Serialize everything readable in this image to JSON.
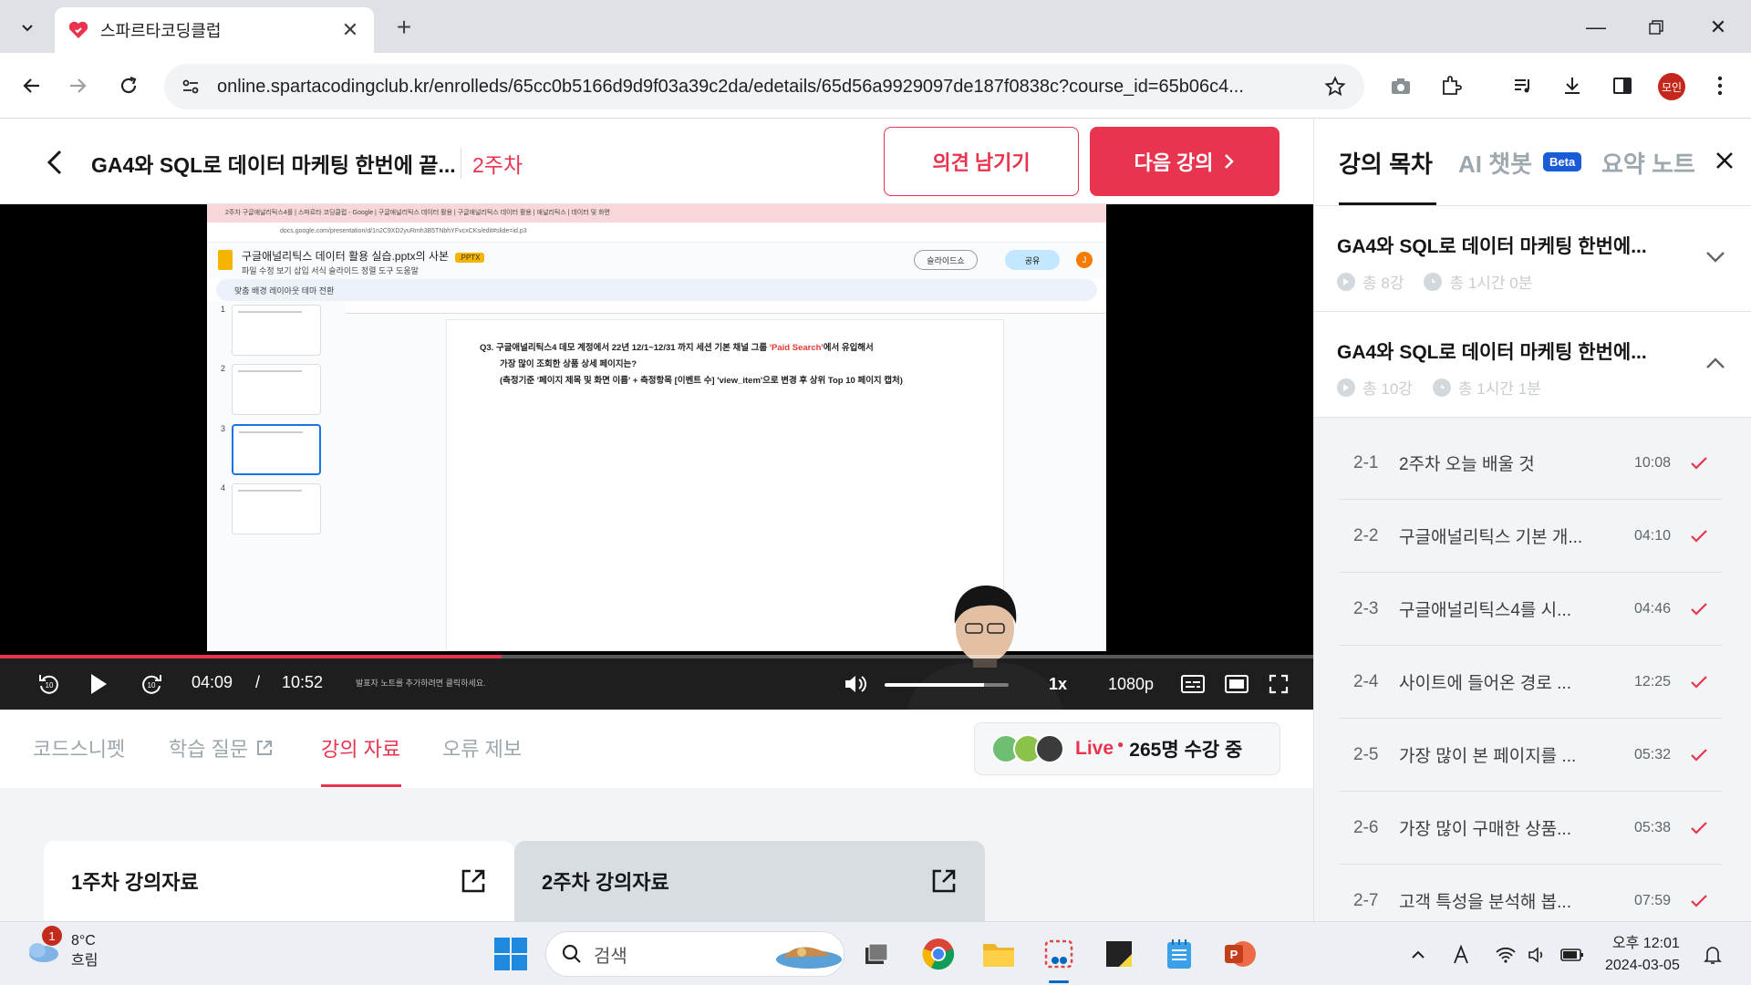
{
  "browser": {
    "tab_title": "스파르타코딩클럽",
    "url": "online.spartacodingclub.kr/enrolleds/65cc0b5166d9d9f03a39c2da/edetails/65d56a9929097de187f0838c?course_id=65b06c4...",
    "profile_label": "모인"
  },
  "header": {
    "course_title": "GA4와 SQL로 데이터 마케팅 한번에 끝...",
    "week_label": "2주차",
    "feedback_button": "의견 남기기",
    "next_button": "다음 강의"
  },
  "video": {
    "current_time": "04:09",
    "separator": "/",
    "duration": "10:52",
    "progress_fraction": 0.382,
    "volume_fraction": 0.8,
    "speed": "1x",
    "quality": "1080p",
    "speaker_notes_hint": "발표자 노트를 추가하려면 클릭하세요.",
    "slides_doc": {
      "browser_tabs": "2주차 구글애널리틱스4를  |  스파르타 코딩클럽 - Google  |  구글애널리틱스 데이터 활용  |  구글애널리틱스 데이터 활용  |  애널리틱스 | 데이터 및 화면",
      "address": "docs.google.com/presentation/d/1n2C9XD2yuRmh3B5TNbhYFvcxCKs/edit#slide=id.p3",
      "title": "구글애널리틱스 데이터 활용 실습.pptx의 사본",
      "badge": ".PPTX",
      "menu": "파일   수정   보기   삽입   서식   슬라이드   정렬   도구   도움말",
      "slideshow_label": "슬라이드쇼",
      "share_label": "공유",
      "avatar_letter": "J",
      "toolbar": "맞춤          배경    레이아웃    테마    전환",
      "thumb_numbers": [
        "1",
        "2",
        "3",
        "4"
      ],
      "question_line1_prefix": "Q3. 구글애널리틱스4 데모 계정에서 22년 12/1~12/31 까지 세션 기본 채널 그룹 ",
      "question_highlight": "'Paid Search'",
      "question_line1_suffix": "에서 유입해서",
      "question_line2": "가장 많이 조회한 상품 상세 페이지는?",
      "question_line3": "(측정기준 '페이지 제목 및 화면 이름' + 측정항목 [이벤트 수] 'view_item'으로 변경 후 상위 Top 10 페이지 캡처)"
    }
  },
  "subtabs": {
    "items": [
      {
        "label": "코드스니펫"
      },
      {
        "label": "학습 질문"
      },
      {
        "label": "강의 자료"
      },
      {
        "label": "오류 제보"
      }
    ],
    "active_index": 2,
    "live_label": "Live",
    "live_count": "265명 수강 중"
  },
  "materials": {
    "cards": [
      {
        "title": "1주차 강의자료"
      },
      {
        "title": "2주차 강의자료"
      }
    ]
  },
  "panel": {
    "tabs": [
      {
        "label": "강의 목차"
      },
      {
        "label": "AI 챗봇"
      },
      {
        "label": "요약 노트"
      }
    ],
    "beta_label": "Beta",
    "weeks": [
      {
        "title": "GA4와 SQL로 데이터 마케팅 한번에...",
        "count": "총 8강",
        "duration": "총 1시간 0분",
        "expanded": false
      },
      {
        "title": "GA4와 SQL로 데이터 마케팅 한번에...",
        "count": "총 10강",
        "duration": "총 1시간 1분",
        "expanded": true
      }
    ],
    "lessons": [
      {
        "num": "2-1",
        "title": "2주차 오늘 배울 것",
        "time": "10:08"
      },
      {
        "num": "2-2",
        "title": "구글애널리틱스 기본 개...",
        "time": "04:10"
      },
      {
        "num": "2-3",
        "title": "구글애널리틱스4를 시...",
        "time": "04:46"
      },
      {
        "num": "2-4",
        "title": "사이트에 들어온 경로 ...",
        "time": "12:25"
      },
      {
        "num": "2-5",
        "title": "가장 많이 본 페이지를 ...",
        "time": "05:32"
      },
      {
        "num": "2-6",
        "title": "가장 많이 구매한 상품...",
        "time": "05:38"
      },
      {
        "num": "2-7",
        "title": "고객 특성을 분석해 봅...",
        "time": "07:59"
      }
    ]
  },
  "taskbar": {
    "weather_temp": "8°C",
    "weather_desc": "흐림",
    "weather_badge": "1",
    "search_placeholder": "검색",
    "clock_time": "오후 12:01",
    "clock_date": "2024-03-05"
  },
  "colors": {
    "accent": "#e8344e",
    "panel_bg": "#f2f4f5",
    "beta": "#1a5bd8"
  }
}
